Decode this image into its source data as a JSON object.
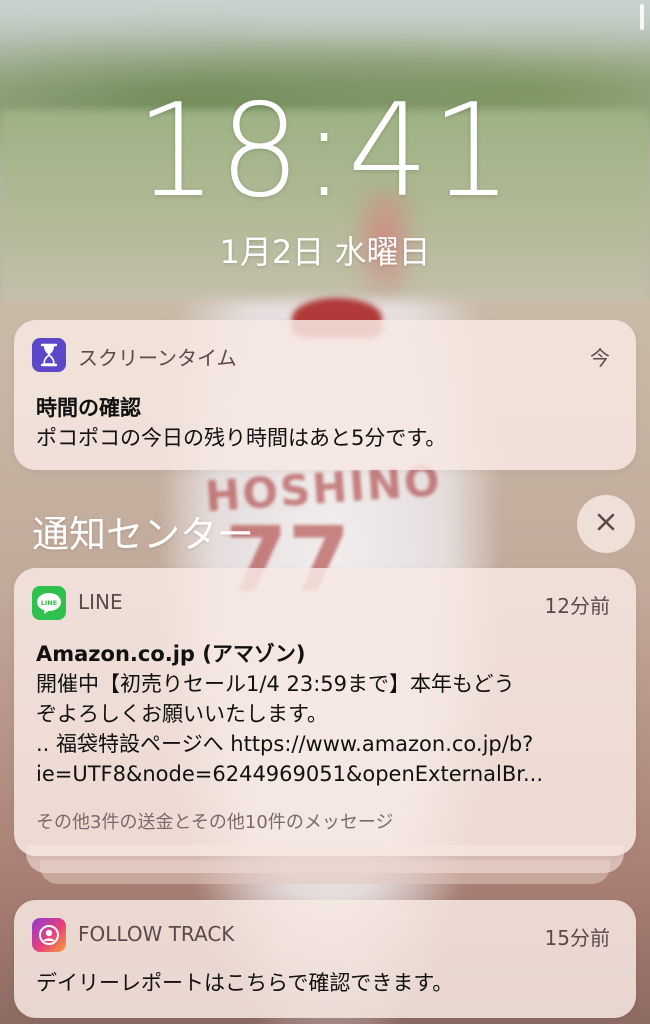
{
  "lockscreen": {
    "time": "18:41",
    "date": "1月2日 水曜日"
  },
  "wallpaper": {
    "jersey_name": "HOSHINO",
    "jersey_number": "77"
  },
  "notifications": {
    "screentime": {
      "app_name": "スクリーンタイム",
      "time": "今",
      "title": "時間の確認",
      "body": "ポコポコの今日の残り時間はあと5分です。"
    },
    "section_header": {
      "title": "通知センター"
    },
    "line": {
      "app_name": "LINE",
      "time": "12分前",
      "title": "Amazon.co.jp (アマゾン)",
      "body_line1": "開催中【初売りセール1/4 23:59まで】本年もどう",
      "body_line2": "ぞよろしくお願いいたします。",
      "body_line3": "..  福袋特設ページへ https://www.amazon.co.jp/b?",
      "body_line4": "ie=UTF8&node=6244969051&openExternalBr...",
      "more": "その他3件の送金とその他10件のメッセージ"
    },
    "followtrack": {
      "app_name": "FOLLOW TRACK",
      "time": "15分前",
      "body": "デイリーレポートはこちらで確認できます。"
    }
  },
  "colors": {
    "screentime_icon": "#5b47c8",
    "line_icon": "#2fc14e",
    "card_background": "#f7e8e2"
  },
  "icons": {
    "screentime": "hourglass-icon",
    "line": "line-chat-icon",
    "followtrack": "follow-track-icon",
    "close": "close-icon"
  }
}
